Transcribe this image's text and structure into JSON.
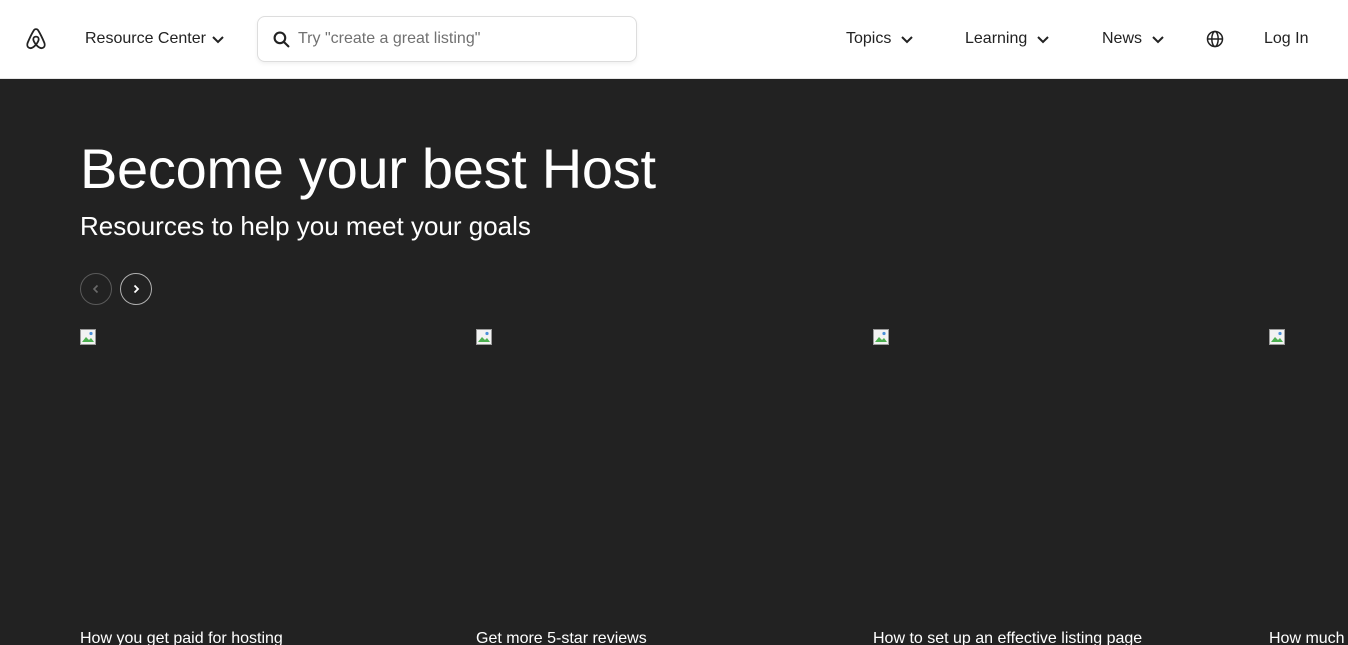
{
  "header": {
    "logo_icon": "airbnb-logo-icon",
    "resource_center_label": "Resource Center",
    "search_placeholder": "Try \"create a great listing\"",
    "nav": [
      {
        "label": "Topics"
      },
      {
        "label": "Learning"
      },
      {
        "label": "News"
      }
    ],
    "globe_icon": "globe-icon",
    "login_label": "Log In"
  },
  "hero": {
    "title": "Become your best Host",
    "subtitle": "Resources to help you meet your goals",
    "background_color": "#222222",
    "cards": [
      {
        "title": "How you get paid for hosting"
      },
      {
        "title": "Get more 5-star reviews"
      },
      {
        "title": "How to set up an effective listing page"
      },
      {
        "title": "How much"
      }
    ]
  }
}
